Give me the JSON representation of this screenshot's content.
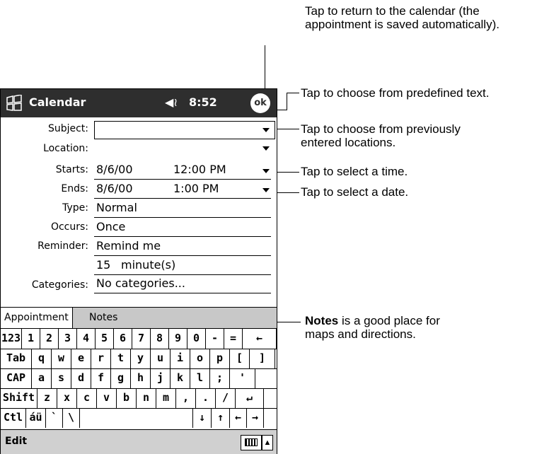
{
  "callouts": {
    "return_line1": "Tap to return to the calendar (the",
    "return_line2": "appointment is saved automatically).",
    "predefined": "Tap to choose from predefined text.",
    "location_line1": "Tap to choose from previously",
    "location_line2": "entered locations.",
    "time": "Tap to select a time.",
    "date": "Tap to select a date.",
    "notes_bold": "Notes",
    "notes_rest": " is a good place for",
    "notes_line2": "maps and directions."
  },
  "titlebar": {
    "app": "Calendar",
    "time": "8:52",
    "ok": "ok"
  },
  "form": {
    "subject_label": "Subject:",
    "location_label": "Location:",
    "starts_label": "Starts:",
    "starts_date": "8/6/00",
    "starts_time": "12:00 PM",
    "ends_label": "Ends:",
    "ends_date": "8/6/00",
    "ends_time": "1:00 PM",
    "type_label": "Type:",
    "type_value": "Normal",
    "occurs_label": "Occurs:",
    "occurs_value": "Once",
    "reminder_label": "Reminder:",
    "reminder_value": "Remind me",
    "reminder_amount": "15",
    "reminder_unit": "minute(s)",
    "categories_label": "Categories:",
    "categories_value": "No categories..."
  },
  "tabs": {
    "appointment": "Appointment",
    "notes": "Notes"
  },
  "keyboard": {
    "row1": [
      "123",
      "1",
      "2",
      "3",
      "4",
      "5",
      "6",
      "7",
      "8",
      "9",
      "0",
      "-",
      "=",
      "←"
    ],
    "row2": [
      "Tab",
      "q",
      "w",
      "e",
      "r",
      "t",
      "y",
      "u",
      "i",
      "o",
      "p",
      "[",
      "]"
    ],
    "row3": [
      "CAP",
      "a",
      "s",
      "d",
      "f",
      "g",
      "h",
      "j",
      "k",
      "l",
      ";",
      "'"
    ],
    "row4": [
      "Shift",
      "z",
      "x",
      "c",
      "v",
      "b",
      "n",
      "m",
      ",",
      ".",
      "/",
      "↵"
    ],
    "row5": [
      "Ctl",
      "áü",
      "`",
      "\\",
      "",
      "↓",
      "↑",
      "←",
      "→"
    ]
  },
  "cmdbar": {
    "edit": "Edit"
  }
}
